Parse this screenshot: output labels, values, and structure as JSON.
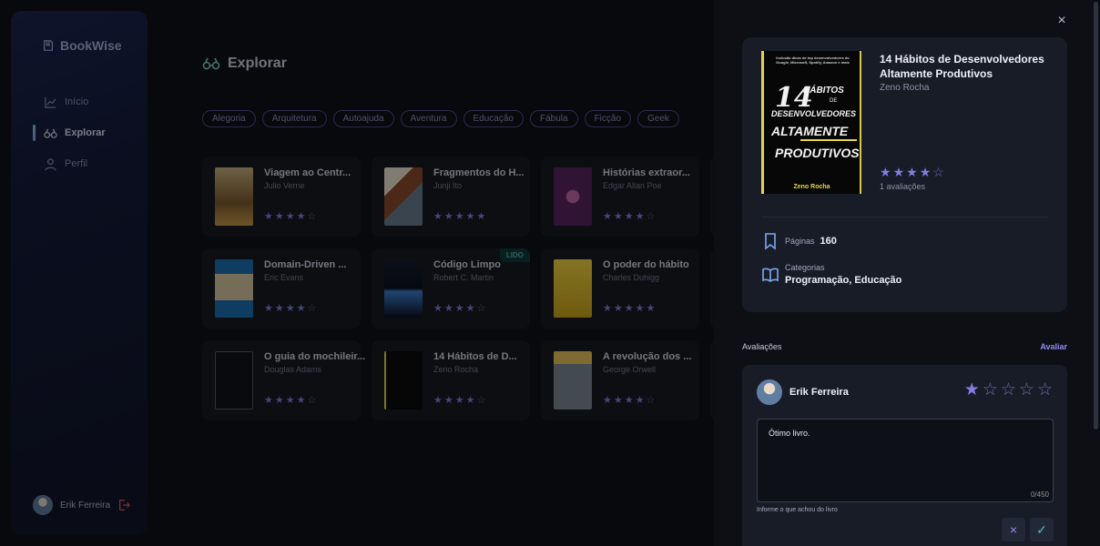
{
  "app": {
    "name": "BookWise"
  },
  "sidebar": {
    "items": [
      {
        "label": "Início",
        "icon": "chart-line-icon",
        "active": false
      },
      {
        "label": "Explorar",
        "icon": "binoculars-icon",
        "active": true
      },
      {
        "label": "Perfil",
        "icon": "user-icon",
        "active": false
      }
    ],
    "user": {
      "name": "Erik Ferreira"
    }
  },
  "explore": {
    "title": "Explorar",
    "tags": [
      "Alegoria",
      "Arquitetura",
      "Autoajuda",
      "Aventura",
      "Educação",
      "Fábula",
      "Ficção",
      "Geek"
    ],
    "books": [
      {
        "title": "Viagem ao Centr...",
        "author": "Julio Verne",
        "rating": 4,
        "read": false
      },
      {
        "title": "Fragmentos do H...",
        "author": "Junji Ito",
        "rating": 5,
        "read": false
      },
      {
        "title": "Histórias extraor...",
        "author": "Edgar Allan Poe",
        "rating": 4,
        "read": false
      },
      {
        "title": "Domain-Driven ...",
        "author": "Eric Evans",
        "rating": 4,
        "read": false
      },
      {
        "title": "Código Limpo",
        "author": "Robert C. Martin",
        "rating": 4,
        "read": true
      },
      {
        "title": "O poder do hábito",
        "author": "Charles Duhigg",
        "rating": 5,
        "read": false
      },
      {
        "title": "O guia do mochileir...",
        "author": "Douglas Adams",
        "rating": 4,
        "read": false
      },
      {
        "title": "14 Hábitos de D...",
        "author": "Zeno Rocha",
        "rating": 4,
        "read": false
      },
      {
        "title": "A revolução dos ...",
        "author": "George Orwell",
        "rating": 4,
        "read": false
      }
    ],
    "read_badge": "LIDO"
  },
  "drawer": {
    "close_label": "×",
    "book": {
      "title": "14 Hábitos de Desenvolvedores Altamente Produtivos",
      "author": "Zeno Rocha",
      "rating": 4,
      "ratings_count": "1 avaliações",
      "pages_label": "Páginas",
      "pages": "160",
      "categories_label": "Categorias",
      "categories": "Programação, Educação",
      "cover": {
        "tagline": "Inclusão dicas de top desenvolvedores do Google, Microsoft, Spotify, Amazon e mais",
        "num": "14",
        "line1": "HÁBITOS",
        "line1b": "DE",
        "line2": "DESENVOLVEDORES",
        "line3": "ALTAMENTE",
        "line4": "PRODUTIVOS",
        "author": "Zeno Rocha"
      }
    },
    "reviews": {
      "label": "Avaliações",
      "rate_link": "Avaliar",
      "form": {
        "user": "Erik Ferreira",
        "rating": 1,
        "text": "Ótimo livro.",
        "counter": "0/450",
        "hint": "Informe o que achou do livro",
        "cancel_icon": "×",
        "confirm_icon": "✓"
      }
    }
  },
  "colors": {
    "accent": "#8f8df2",
    "teal": "#50b2a6",
    "card": "#181c27"
  }
}
